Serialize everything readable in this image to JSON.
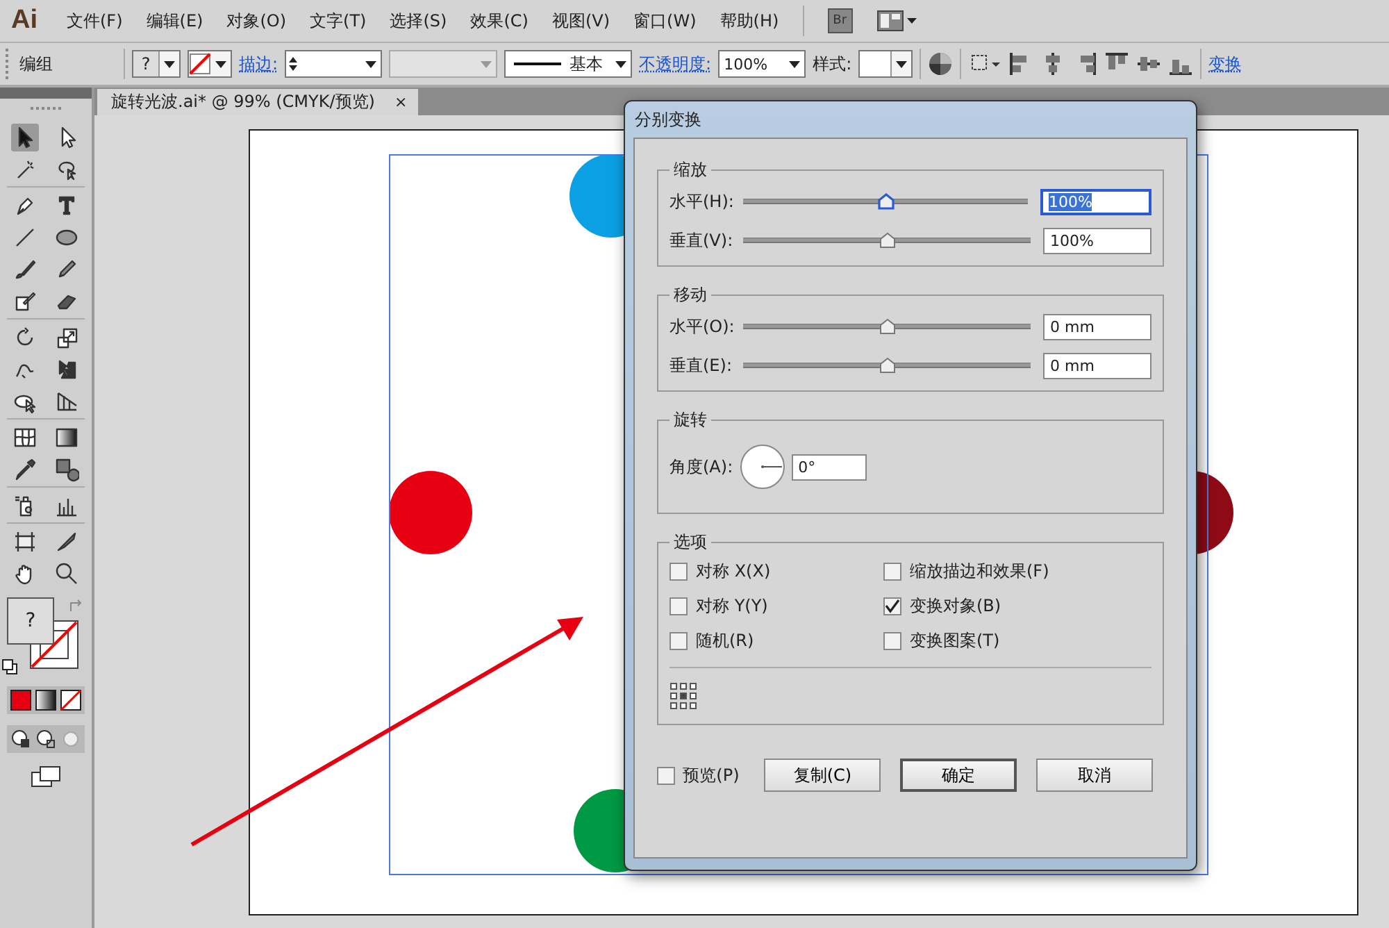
{
  "app": {
    "logo": "Ai",
    "bridge": "Br"
  },
  "menu": [
    "文件(F)",
    "编辑(E)",
    "对象(O)",
    "文字(T)",
    "选择(S)",
    "效果(C)",
    "视图(V)",
    "窗口(W)",
    "帮助(H)"
  ],
  "control_bar": {
    "selection": "编组",
    "fill_swatch": "?",
    "stroke_link": "描边:",
    "profile": "基本",
    "opacity_link": "不透明度:",
    "opacity": "100%",
    "style_label": "样式:",
    "transform_link": "变换"
  },
  "document_tab": {
    "title": "旋转光波.ai* @ 99% (CMYK/预览)",
    "close": "×"
  },
  "toolbox": {
    "fill_swatch": "?"
  },
  "canvas": {
    "circles": [
      {
        "color": "#0b9fe3"
      },
      {
        "color": "#e60012"
      },
      {
        "color": "#009944"
      },
      {
        "color": "#8e0b16"
      }
    ]
  },
  "dialog": {
    "title": "分别变换",
    "scale": {
      "title": "缩放",
      "rows": [
        {
          "label": "水平(H):",
          "level": 0.5,
          "value": "100%",
          "focused": true
        },
        {
          "label": "垂直(V):",
          "level": 0.5,
          "value": "100%",
          "focused": false
        }
      ]
    },
    "move": {
      "title": "移动",
      "rows": [
        {
          "label": "水平(O):",
          "level": 0.5,
          "value": "0 mm",
          "focused": false
        },
        {
          "label": "垂直(E):",
          "level": 0.5,
          "value": "0 mm",
          "focused": false
        }
      ]
    },
    "rotate": {
      "title": "旋转",
      "label": "角度(A):",
      "value": "0°"
    },
    "options": {
      "title": "选项",
      "checkboxes": [
        {
          "label": "对称 X(X)",
          "checked": false
        },
        {
          "label": "缩放描边和效果(F)",
          "checked": false
        },
        {
          "label": "对称 Y(Y)",
          "checked": false
        },
        {
          "label": "变换对象(B)",
          "checked": true
        },
        {
          "label": "随机(R)",
          "checked": false
        },
        {
          "label": "变换图案(T)",
          "checked": false
        }
      ]
    },
    "preview": {
      "label": "预览(P)",
      "checked": false
    },
    "buttons": [
      {
        "label": "复制(C)",
        "default": false
      },
      {
        "label": "确定",
        "default": true
      },
      {
        "label": "取消",
        "default": false
      }
    ]
  }
}
